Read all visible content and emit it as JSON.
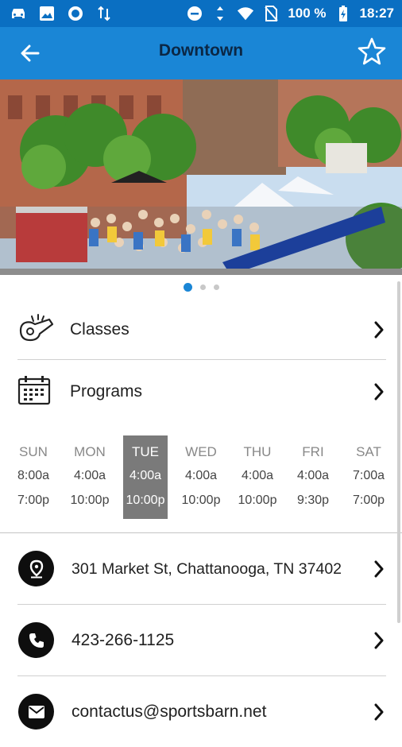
{
  "status_bar": {
    "battery": "100 %",
    "time": "18:27"
  },
  "header": {
    "title": "Downtown"
  },
  "carousel": {
    "page_count": 3,
    "active_index": 0
  },
  "menu": {
    "classes_label": "Classes",
    "programs_label": "Programs"
  },
  "hours": {
    "today_index": 2,
    "days": [
      {
        "name": "SUN",
        "open": "8:00a",
        "close": "7:00p"
      },
      {
        "name": "MON",
        "open": "4:00a",
        "close": "10:00p"
      },
      {
        "name": "TUE",
        "open": "4:00a",
        "close": "10:00p"
      },
      {
        "name": "WED",
        "open": "4:00a",
        "close": "10:00p"
      },
      {
        "name": "THU",
        "open": "4:00a",
        "close": "10:00p"
      },
      {
        "name": "FRI",
        "open": "4:00a",
        "close": "9:30p"
      },
      {
        "name": "SAT",
        "open": "7:00a",
        "close": "7:00p"
      }
    ]
  },
  "contact": {
    "address": "301 Market St, Chattanooga, TN 37402",
    "phone": "423-266-1125",
    "email": "contactus@sportsbarn.net"
  },
  "colors": {
    "status_bar": "#0a6fc2",
    "app_bar": "#1a86d6",
    "title_text": "#0b2745",
    "today_highlight": "#7a7a7a"
  }
}
